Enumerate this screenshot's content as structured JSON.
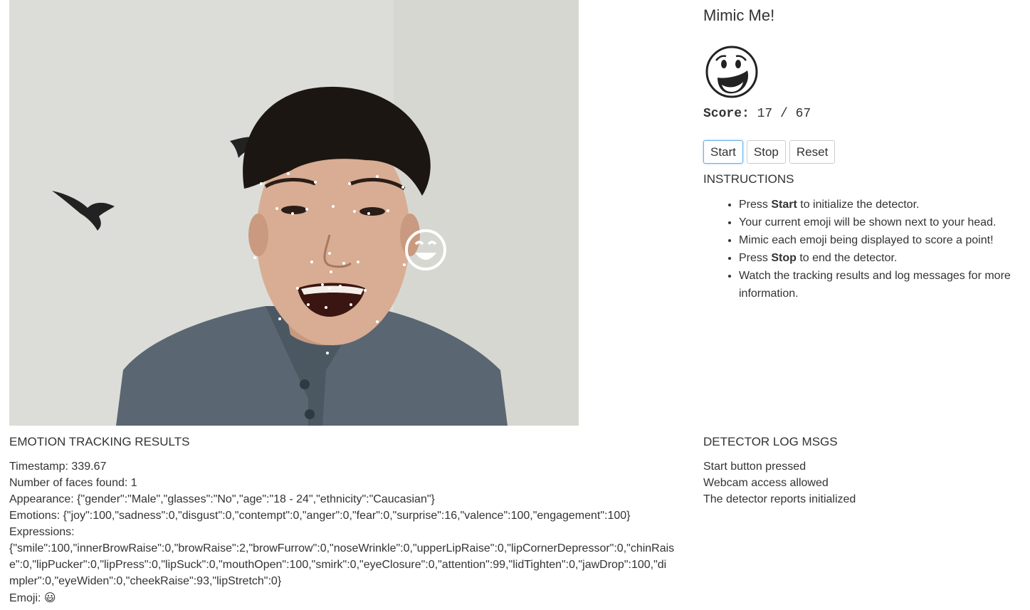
{
  "app": {
    "title": "Mimic Me!"
  },
  "target_emoji": {
    "icon": "laughing-emoji-icon"
  },
  "score": {
    "label": "Score:",
    "value": "17 / 67"
  },
  "buttons": {
    "start": "Start",
    "stop": "Stop",
    "reset": "Reset"
  },
  "instructions": {
    "heading": "INSTRUCTIONS",
    "items": [
      {
        "pre": "Press ",
        "bold": "Start",
        "post": " to initialize the detector."
      },
      {
        "pre": "Your current emoji will be shown next to your head.",
        "bold": "",
        "post": ""
      },
      {
        "pre": "Mimic each emoji being displayed to score a point!",
        "bold": "",
        "post": ""
      },
      {
        "pre": "Press ",
        "bold": "Stop",
        "post": " to end the detector."
      },
      {
        "pre": "Watch the tracking results and log messages for more information.",
        "bold": "",
        "post": ""
      }
    ]
  },
  "webcam": {
    "overlay_icon": "smiling-emoji-icon",
    "landmark_color": "#ffffff"
  },
  "results": {
    "heading": "EMOTION TRACKING RESULTS",
    "timestamp": "Timestamp: 339.67",
    "faces": "Number of faces found: 1",
    "appearance": "Appearance: {\"gender\":\"Male\",\"glasses\":\"No\",\"age\":\"18 - 24\",\"ethnicity\":\"Caucasian\"}",
    "emotions": "Emotions: {\"joy\":100,\"sadness\":0,\"disgust\":0,\"contempt\":0,\"anger\":0,\"fear\":0,\"surprise\":16,\"valence\":100,\"engagement\":100}",
    "expressions_label": "Expressions:",
    "expressions_value": "{\"smile\":100,\"innerBrowRaise\":0,\"browRaise\":2,\"browFurrow\":0,\"noseWrinkle\":0,\"upperLipRaise\":0,\"lipCornerDepressor\":0,\"chinRaise\":0,\"lipPucker\":0,\"lipPress\":0,\"lipSuck\":0,\"mouthOpen\":100,\"smirk\":0,\"eyeClosure\":0,\"attention\":99,\"lidTighten\":0,\"jawDrop\":100,\"dimpler\":0,\"eyeWiden\":0,\"cheekRaise\":93,\"lipStretch\":0}",
    "emoji_label": "Emoji: ",
    "emoji_value": "😃"
  },
  "log": {
    "heading": "DETECTOR LOG MSGS",
    "messages": [
      "Start button pressed",
      "Webcam access allowed",
      "The detector reports initialized"
    ]
  }
}
